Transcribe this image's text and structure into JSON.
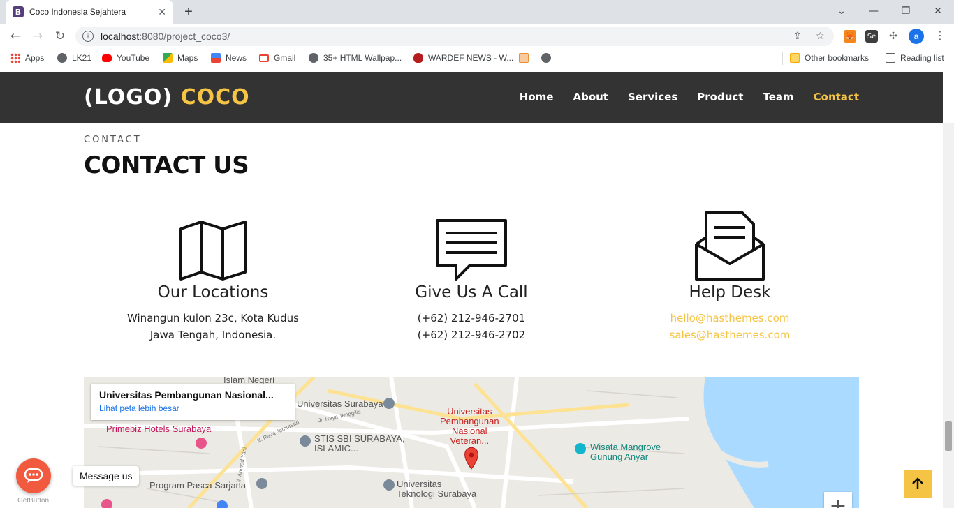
{
  "browser": {
    "tab": {
      "title": "Coco Indonesia Sejahtera",
      "favicon": "B"
    },
    "new_tab": "+",
    "window_controls": {
      "minimize": "—",
      "restore": "❐",
      "close": "✕",
      "tabsearch": "⌄"
    },
    "url_host": "localhost",
    "url_rest": ":8080/project_coco3/",
    "avatar": "a",
    "bookmarks": [
      {
        "label": "Apps",
        "icon": "apps-grid-icon",
        "color": "#4285f4"
      },
      {
        "label": "LK21",
        "icon": "globe-icon",
        "color": "#5f6368"
      },
      {
        "label": "YouTube",
        "icon": "youtube-icon",
        "color": "#ff0000"
      },
      {
        "label": "Maps",
        "icon": "maps-icon",
        "color": "#34a853"
      },
      {
        "label": "News",
        "icon": "news-icon",
        "color": "#4285f4"
      },
      {
        "label": "Gmail",
        "icon": "gmail-icon",
        "color": "#ea4335"
      },
      {
        "label": "35+ HTML Wallpap...",
        "icon": "globe-icon",
        "color": "#5f6368"
      },
      {
        "label": "WARDEF NEWS - W...",
        "icon": "wardef-icon",
        "color": "#b71c1c"
      }
    ],
    "other_bookmarks": "Other bookmarks",
    "reading_list": "Reading list"
  },
  "header": {
    "logo_prefix": "(LOGO)",
    "logo_name": "COCO",
    "nav": [
      "Home",
      "About",
      "Services",
      "Product",
      "Team",
      "Contact"
    ],
    "active_nav": "Contact"
  },
  "contact": {
    "kicker": "CONTACT",
    "title": "CONTACT US",
    "locations": {
      "heading": "Our Locations",
      "lines": [
        "Winangun kulon 23c, Kota Kudus",
        "Jawa Tengah, Indonesia."
      ]
    },
    "call": {
      "heading": "Give Us A Call",
      "lines": [
        "(+62) 212-946-2701",
        "(+62) 212-946-2702"
      ]
    },
    "helpdesk": {
      "heading": "Help Desk",
      "lines": [
        "hello@hasthemes.com",
        "sales@hasthemes.com"
      ]
    }
  },
  "map": {
    "card_title": "Universitas Pembangunan Nasional...",
    "card_link": "Lihat peta lebih besar",
    "labels": {
      "islam": "Islam Negeri",
      "unisurabaya": "Universitas Surabaya",
      "primebiz": "Primebiz Hotels Surabaya",
      "stis": "STIS SBI SURABAYA,\nISLAMIC...",
      "upn": "Universitas\nPembangunan\nNasional\nVeteran...",
      "mangrove": "Wisata Mangrove\nGunung Anyar",
      "pasca": "Program Pasca Sarjana",
      "its": "Universitas\nTeknologi Surabaya",
      "road1": "Jl. Raya Tenggilis",
      "road2": "Jl. Raya Jemursari",
      "road3": "Jl. Ahmad Yani"
    },
    "zoom_in": "+"
  },
  "widgets": {
    "message_us": "Message us",
    "getbutton": "GetButton"
  },
  "colors": {
    "accent": "#f6c445",
    "header_bg": "#333333",
    "chat": "#f25a3f"
  }
}
